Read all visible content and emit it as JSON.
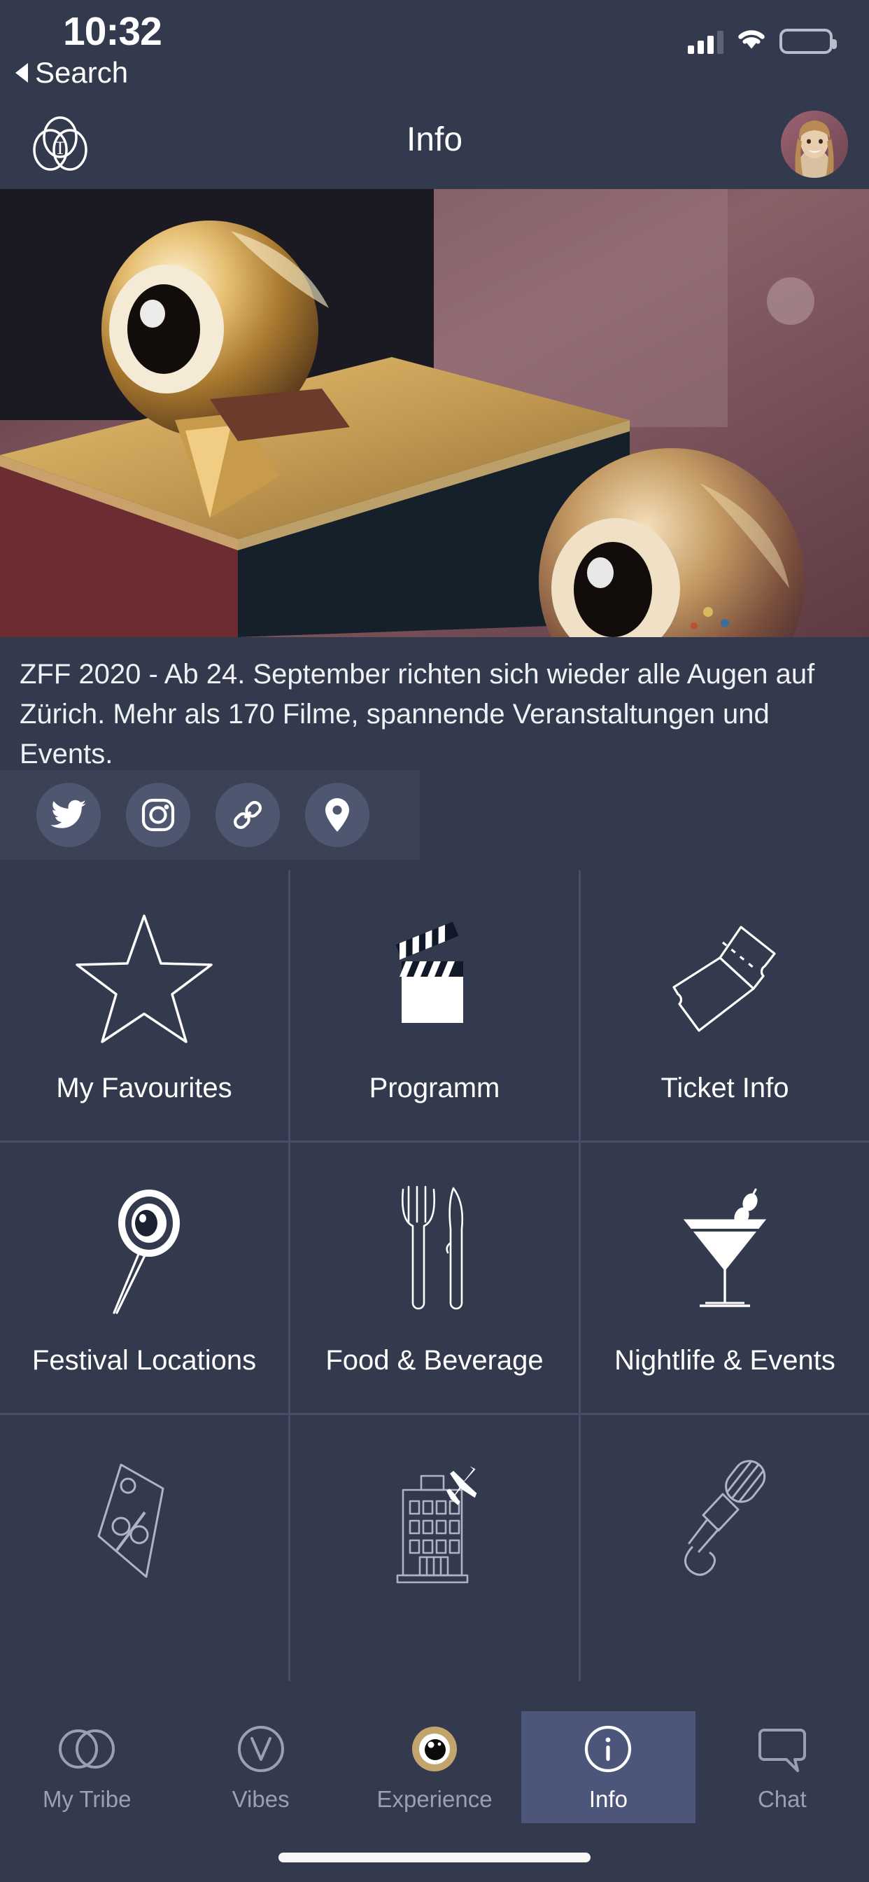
{
  "status_bar": {
    "time": "10:32",
    "back_label": "Search",
    "back_icon": "triangle-left-icon",
    "signal_icon": "cellular-signal-icon",
    "signal_bars": 4,
    "signal_active_bars": 3,
    "wifi_icon": "wifi-icon",
    "battery_icon": "battery-full-icon"
  },
  "nav_bar": {
    "title": "Info",
    "logo_icon": "tribe-venn-logo-icon",
    "avatar_icon": "user-avatar"
  },
  "hero": {
    "image_alt": "golden eye award trophies on pedestal"
  },
  "description": {
    "text": "ZFF 2020 - Ab 24. September richten sich wieder alle Augen auf Zürich. Mehr als 170 Filme, spannende Veranstaltungen und Events."
  },
  "social": [
    {
      "name": "twitter-icon",
      "label": "Twitter"
    },
    {
      "name": "instagram-icon",
      "label": "Instagram"
    },
    {
      "name": "link-icon",
      "label": "Website"
    },
    {
      "name": "location-pin-icon",
      "label": "Location"
    }
  ],
  "tiles": [
    {
      "label": "My Favourites",
      "icon": "star-outline-icon"
    },
    {
      "label": "Programm",
      "icon": "clapperboard-icon"
    },
    {
      "label": "Ticket Info",
      "icon": "tickets-icon"
    },
    {
      "label": "Festival Locations",
      "icon": "map-pin-eye-icon"
    },
    {
      "label": "Food & Beverage",
      "icon": "fork-knife-icon"
    },
    {
      "label": "Nightlife & Events",
      "icon": "cocktail-glass-icon"
    },
    {
      "label": "",
      "icon": "discount-tag-icon"
    },
    {
      "label": "",
      "icon": "hotel-plane-icon"
    },
    {
      "label": "",
      "icon": "microphone-icon"
    }
  ],
  "tabs": [
    {
      "label": "My Tribe",
      "icon": "venn-circles-icon",
      "active": false
    },
    {
      "label": "Vibes",
      "icon": "v-circle-icon",
      "active": false
    },
    {
      "label": "Experience",
      "icon": "gold-eye-icon",
      "active": false
    },
    {
      "label": "Info",
      "icon": "info-circle-icon",
      "active": true
    },
    {
      "label": "Chat",
      "icon": "speech-bubble-icon",
      "active": false
    }
  ],
  "colors": {
    "background": "#333a4d",
    "panel": "#3b4256",
    "separator": "#474f66",
    "accent_active_tab": "#4c567a",
    "gold": "#c2a56d",
    "muted_text": "#9aa0b2",
    "social_button": "#4e5670"
  }
}
